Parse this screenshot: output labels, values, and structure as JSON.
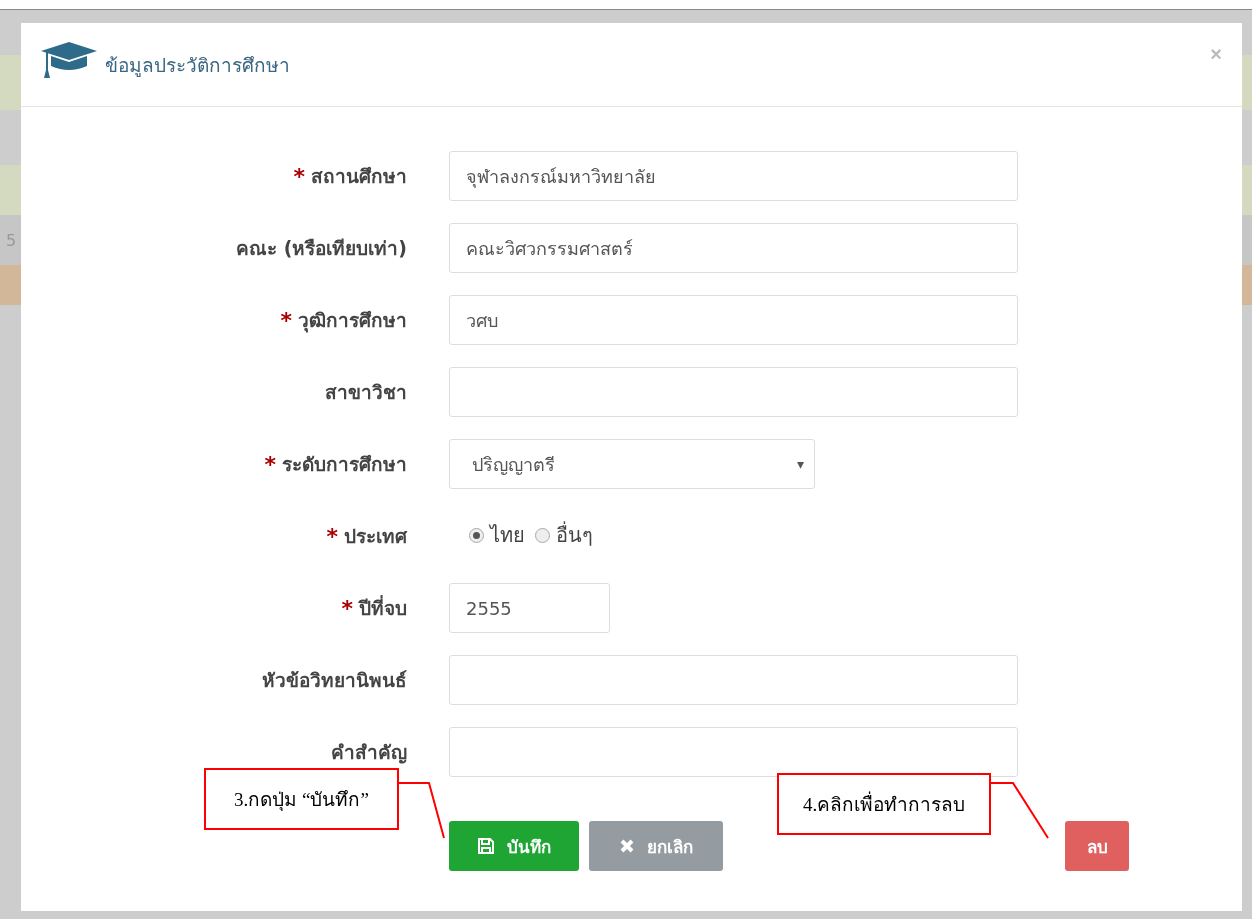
{
  "background": {
    "fragment": "5"
  },
  "modal": {
    "title": "ข้อมูลประวัติการศึกษา",
    "close": "×"
  },
  "fields": [
    {
      "kind": "text",
      "label": "สถานศึกษา",
      "required": true,
      "value": "จุฬาลงกรณ์มหาวิทยาลัย"
    },
    {
      "kind": "text",
      "label": "คณะ (หรือเทียบเท่า)",
      "required": false,
      "value": "คณะวิศวกรรมศาสตร์"
    },
    {
      "kind": "text",
      "label": "วุฒิการศึกษา",
      "required": true,
      "value": "วศบ"
    },
    {
      "kind": "text",
      "label": "สาขาวิชา",
      "required": false
    },
    {
      "kind": "select",
      "label": "ระดับการศึกษา",
      "required": true,
      "value": "ปริญญาตรี",
      "caret": "▾"
    },
    {
      "kind": "radio",
      "label": "ประเทศ",
      "required": true,
      "options": [
        {
          "label": "ไทย",
          "selected": true
        },
        {
          "label": "อื่นๆ",
          "selected": false
        }
      ]
    },
    {
      "kind": "short",
      "label": "ปีที่จบ",
      "required": true,
      "value": "2555"
    },
    {
      "kind": "text",
      "label": "หัวข้อวิทยานิพนธ์",
      "required": false
    },
    {
      "kind": "text",
      "label": "คำสำคัญ",
      "required": false
    }
  ],
  "required_mark": "*",
  "buttons": [
    {
      "kind": "save",
      "label": "บันทึก"
    },
    {
      "kind": "cancel",
      "label": "ยกเลิก"
    },
    {
      "kind": "delete",
      "label": "ลบ"
    }
  ],
  "callouts": [
    {
      "text": "3.กดปุ่ม “บันทึก”"
    },
    {
      "text": "4.คลิกเพื่อทำการลบ"
    }
  ]
}
